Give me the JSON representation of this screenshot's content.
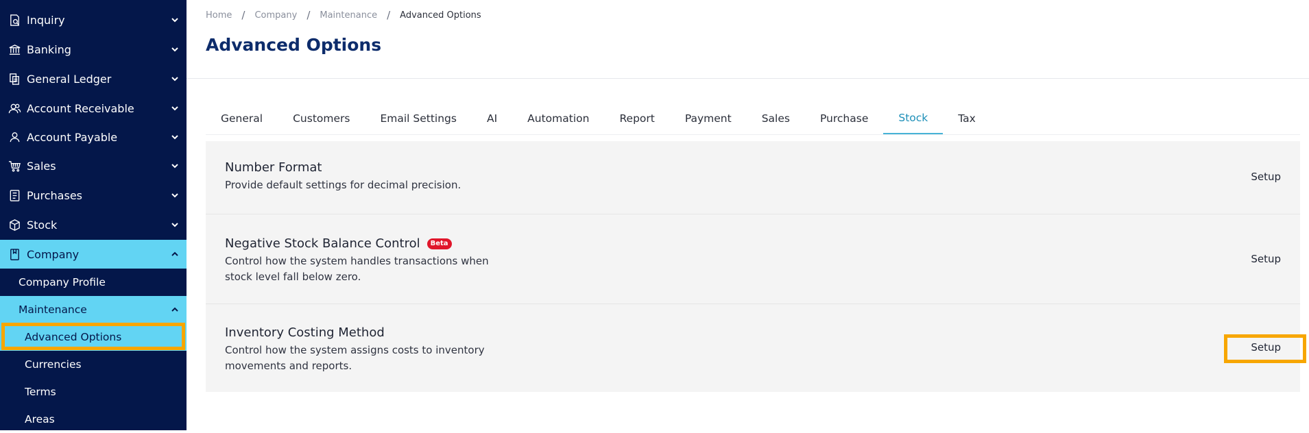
{
  "sidebar": {
    "items": [
      {
        "label": "Inquiry",
        "icon": "inquiry-icon"
      },
      {
        "label": "Banking",
        "icon": "bank-icon"
      },
      {
        "label": "General Ledger",
        "icon": "ledger-icon"
      },
      {
        "label": "Account Receivable",
        "icon": "users-icon"
      },
      {
        "label": "Account Payable",
        "icon": "user-icon"
      },
      {
        "label": "Sales",
        "icon": "cart-icon"
      },
      {
        "label": "Purchases",
        "icon": "receipt-icon"
      },
      {
        "label": "Stock",
        "icon": "box-icon"
      },
      {
        "label": "Company",
        "icon": "bookmark-icon"
      }
    ],
    "company_sub": {
      "company_profile": "Company Profile",
      "maintenance": "Maintenance",
      "maintenance_sub": [
        "Advanced Options",
        "Currencies",
        "Terms",
        "Areas"
      ]
    },
    "active_color": "#62d4f3",
    "background_color": "#04174a"
  },
  "breadcrumb": [
    "Home",
    "Company",
    "Maintenance",
    "Advanced Options"
  ],
  "page_title": "Advanced Options",
  "tabs": [
    "General",
    "Customers",
    "Email Settings",
    "AI",
    "Automation",
    "Report",
    "Payment",
    "Sales",
    "Purchase",
    "Stock",
    "Tax"
  ],
  "active_tab": "Stock",
  "options": [
    {
      "title": "Number Format",
      "description": "Provide default settings for decimal precision.",
      "action": "Setup"
    },
    {
      "title": "Negative Stock Balance Control",
      "badge": "Beta",
      "description": "Control how the system handles transactions when stock level fall below zero.",
      "action": "Setup"
    },
    {
      "title": "Inventory Costing Method",
      "description": "Control how the system assigns costs to inventory movements and reports.",
      "action": "Setup"
    }
  ],
  "highlight_color": "#f7a600"
}
